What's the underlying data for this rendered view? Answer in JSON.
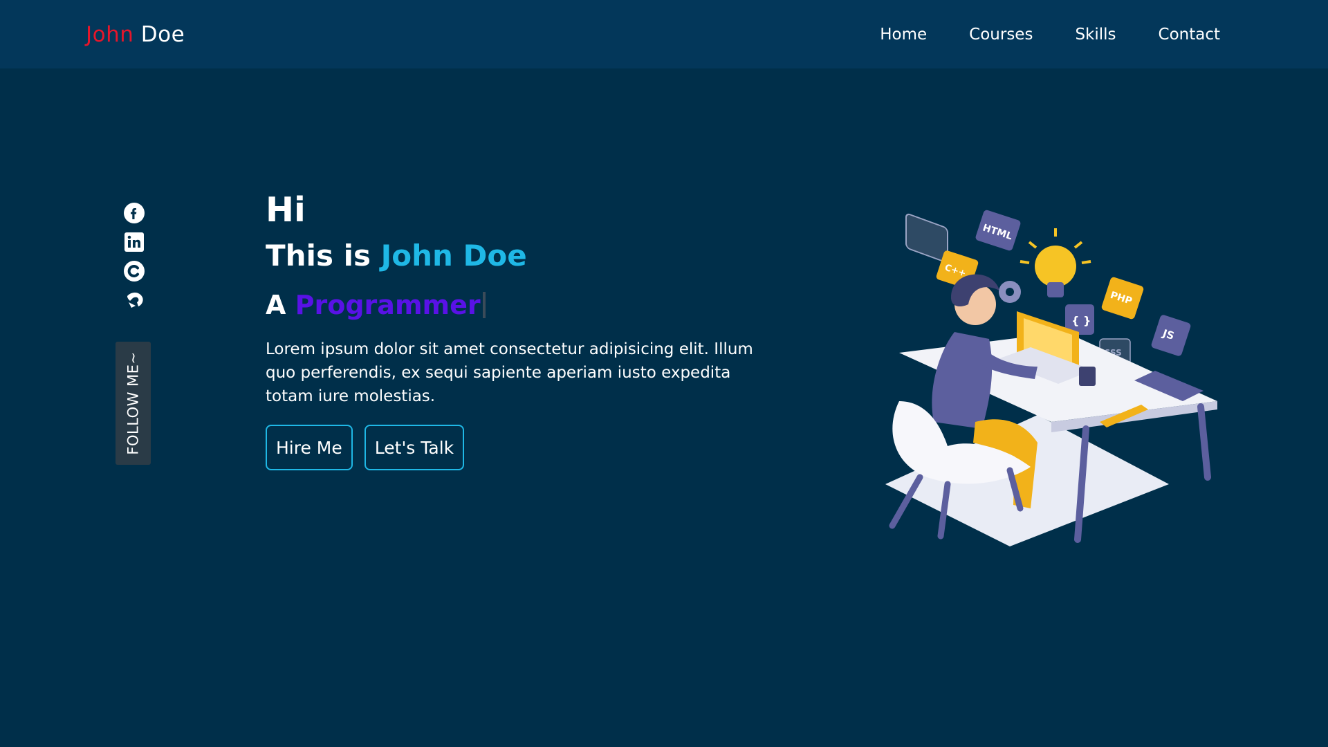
{
  "brand": {
    "first": "John",
    "last": "Doe",
    "first_color": "#e5162b"
  },
  "nav": {
    "items": [
      {
        "label": "Home"
      },
      {
        "label": "Courses"
      },
      {
        "label": "Skills"
      },
      {
        "label": "Contact"
      }
    ]
  },
  "social": {
    "icons": [
      "facebook-icon",
      "linkedin-icon",
      "codepen-icon",
      "github-icon"
    ],
    "follow_label": "FOLLOW ME~"
  },
  "hero": {
    "greeting": "Hi",
    "intro_prefix": "This is",
    "name": "John Doe",
    "role_prefix": "A",
    "role": "Programmer",
    "description": "Lorem ipsum dolor sit amet consectetur adipisicing elit. Illum quo perferendis, ex sequi sapiente aperiam iusto expedita totam iure molestias.",
    "buttons": {
      "hire": "Hire Me",
      "talk": "Let's Talk"
    }
  },
  "illustration": {
    "tags": [
      "HTML",
      "C++",
      "PHP",
      "JS",
      "{ }",
      "CSS"
    ]
  },
  "colors": {
    "background": "#002f4a",
    "navbar": "#03375a",
    "accent": "#1fb8e6",
    "role": "#5912e6",
    "brand_red": "#e5162b"
  }
}
